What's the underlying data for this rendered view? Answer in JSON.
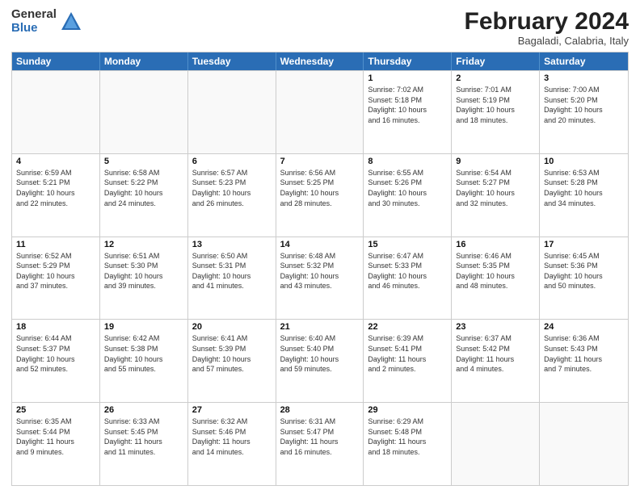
{
  "logo": {
    "general": "General",
    "blue": "Blue"
  },
  "title": "February 2024",
  "location": "Bagaladi, Calabria, Italy",
  "days_of_week": [
    "Sunday",
    "Monday",
    "Tuesday",
    "Wednesday",
    "Thursday",
    "Friday",
    "Saturday"
  ],
  "weeks": [
    [
      {
        "day": "",
        "info": ""
      },
      {
        "day": "",
        "info": ""
      },
      {
        "day": "",
        "info": ""
      },
      {
        "day": "",
        "info": ""
      },
      {
        "day": "1",
        "info": "Sunrise: 7:02 AM\nSunset: 5:18 PM\nDaylight: 10 hours\nand 16 minutes."
      },
      {
        "day": "2",
        "info": "Sunrise: 7:01 AM\nSunset: 5:19 PM\nDaylight: 10 hours\nand 18 minutes."
      },
      {
        "day": "3",
        "info": "Sunrise: 7:00 AM\nSunset: 5:20 PM\nDaylight: 10 hours\nand 20 minutes."
      }
    ],
    [
      {
        "day": "4",
        "info": "Sunrise: 6:59 AM\nSunset: 5:21 PM\nDaylight: 10 hours\nand 22 minutes."
      },
      {
        "day": "5",
        "info": "Sunrise: 6:58 AM\nSunset: 5:22 PM\nDaylight: 10 hours\nand 24 minutes."
      },
      {
        "day": "6",
        "info": "Sunrise: 6:57 AM\nSunset: 5:23 PM\nDaylight: 10 hours\nand 26 minutes."
      },
      {
        "day": "7",
        "info": "Sunrise: 6:56 AM\nSunset: 5:25 PM\nDaylight: 10 hours\nand 28 minutes."
      },
      {
        "day": "8",
        "info": "Sunrise: 6:55 AM\nSunset: 5:26 PM\nDaylight: 10 hours\nand 30 minutes."
      },
      {
        "day": "9",
        "info": "Sunrise: 6:54 AM\nSunset: 5:27 PM\nDaylight: 10 hours\nand 32 minutes."
      },
      {
        "day": "10",
        "info": "Sunrise: 6:53 AM\nSunset: 5:28 PM\nDaylight: 10 hours\nand 34 minutes."
      }
    ],
    [
      {
        "day": "11",
        "info": "Sunrise: 6:52 AM\nSunset: 5:29 PM\nDaylight: 10 hours\nand 37 minutes."
      },
      {
        "day": "12",
        "info": "Sunrise: 6:51 AM\nSunset: 5:30 PM\nDaylight: 10 hours\nand 39 minutes."
      },
      {
        "day": "13",
        "info": "Sunrise: 6:50 AM\nSunset: 5:31 PM\nDaylight: 10 hours\nand 41 minutes."
      },
      {
        "day": "14",
        "info": "Sunrise: 6:48 AM\nSunset: 5:32 PM\nDaylight: 10 hours\nand 43 minutes."
      },
      {
        "day": "15",
        "info": "Sunrise: 6:47 AM\nSunset: 5:33 PM\nDaylight: 10 hours\nand 46 minutes."
      },
      {
        "day": "16",
        "info": "Sunrise: 6:46 AM\nSunset: 5:35 PM\nDaylight: 10 hours\nand 48 minutes."
      },
      {
        "day": "17",
        "info": "Sunrise: 6:45 AM\nSunset: 5:36 PM\nDaylight: 10 hours\nand 50 minutes."
      }
    ],
    [
      {
        "day": "18",
        "info": "Sunrise: 6:44 AM\nSunset: 5:37 PM\nDaylight: 10 hours\nand 52 minutes."
      },
      {
        "day": "19",
        "info": "Sunrise: 6:42 AM\nSunset: 5:38 PM\nDaylight: 10 hours\nand 55 minutes."
      },
      {
        "day": "20",
        "info": "Sunrise: 6:41 AM\nSunset: 5:39 PM\nDaylight: 10 hours\nand 57 minutes."
      },
      {
        "day": "21",
        "info": "Sunrise: 6:40 AM\nSunset: 5:40 PM\nDaylight: 10 hours\nand 59 minutes."
      },
      {
        "day": "22",
        "info": "Sunrise: 6:39 AM\nSunset: 5:41 PM\nDaylight: 11 hours\nand 2 minutes."
      },
      {
        "day": "23",
        "info": "Sunrise: 6:37 AM\nSunset: 5:42 PM\nDaylight: 11 hours\nand 4 minutes."
      },
      {
        "day": "24",
        "info": "Sunrise: 6:36 AM\nSunset: 5:43 PM\nDaylight: 11 hours\nand 7 minutes."
      }
    ],
    [
      {
        "day": "25",
        "info": "Sunrise: 6:35 AM\nSunset: 5:44 PM\nDaylight: 11 hours\nand 9 minutes."
      },
      {
        "day": "26",
        "info": "Sunrise: 6:33 AM\nSunset: 5:45 PM\nDaylight: 11 hours\nand 11 minutes."
      },
      {
        "day": "27",
        "info": "Sunrise: 6:32 AM\nSunset: 5:46 PM\nDaylight: 11 hours\nand 14 minutes."
      },
      {
        "day": "28",
        "info": "Sunrise: 6:31 AM\nSunset: 5:47 PM\nDaylight: 11 hours\nand 16 minutes."
      },
      {
        "day": "29",
        "info": "Sunrise: 6:29 AM\nSunset: 5:48 PM\nDaylight: 11 hours\nand 18 minutes."
      },
      {
        "day": "",
        "info": ""
      },
      {
        "day": "",
        "info": ""
      }
    ]
  ]
}
